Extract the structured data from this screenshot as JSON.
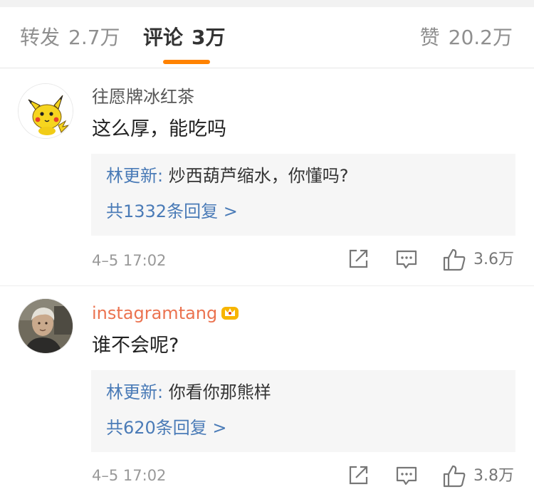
{
  "tabs": {
    "forward": {
      "label": "转发",
      "count": "2.7万"
    },
    "comments": {
      "label": "评论",
      "count": "3万"
    },
    "likes": {
      "label": "赞",
      "count": "20.2万"
    }
  },
  "comments": [
    {
      "username": "往愿牌冰红茶",
      "text": "这么厚，能吃吗",
      "reply_author": "林更新:",
      "reply_text": " 炒西葫芦缩水，你懂吗?",
      "reply_count": "共1332条回复 >",
      "time": "4–5 17:02",
      "likes": "3.6万",
      "avatar_icon": "pikachu-avatar"
    },
    {
      "username": "instagramtang",
      "vip_badge_icon": "crown-badge-icon",
      "text": "谁不会呢?",
      "reply_author": "林更新:",
      "reply_text": " 你看你那熊样",
      "reply_count": "共620条回复 >",
      "time": "4–5 17:02",
      "likes": "3.8万",
      "avatar_icon": "person-photo-avatar"
    }
  ],
  "colors": {
    "accent": "#ff8200",
    "link_blue": "#4a7bb7",
    "vip_name": "#eb7350"
  }
}
